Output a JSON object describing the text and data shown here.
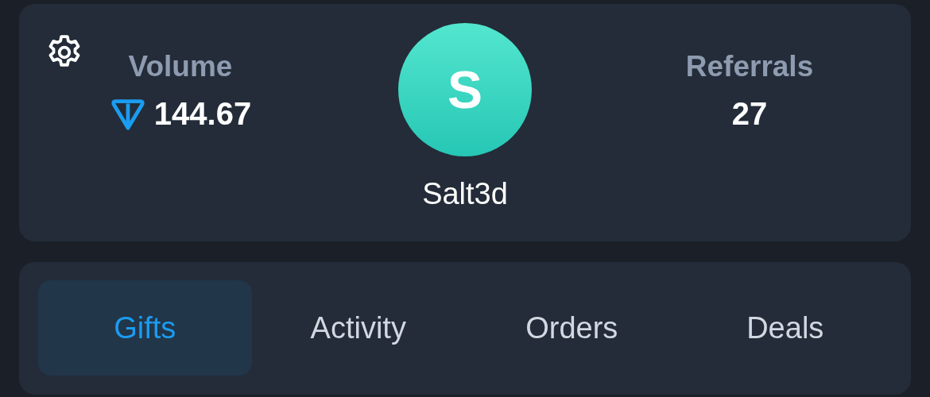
{
  "profile": {
    "avatar_letter": "S",
    "name": "Salt3d"
  },
  "stats": [
    {
      "kind": "volume",
      "label": "Volume",
      "value": "144.67"
    },
    {
      "kind": "plain",
      "label": "Referrals",
      "value": "27"
    }
  ],
  "tabs": [
    {
      "label": "Gifts",
      "selected": true
    },
    {
      "label": "Activity",
      "selected": false
    },
    {
      "label": "Orders",
      "selected": false
    },
    {
      "label": "Deals",
      "selected": false
    }
  ]
}
